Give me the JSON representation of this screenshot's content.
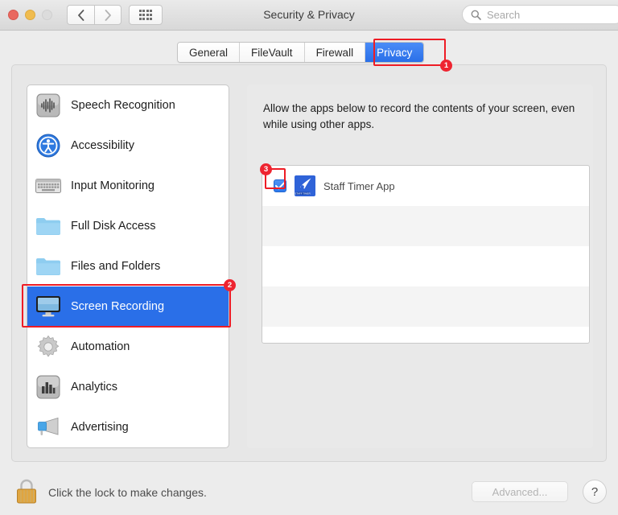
{
  "window": {
    "title": "Security & Privacy",
    "traffic_lights": [
      "close",
      "minimize",
      "zoom"
    ],
    "nav": {
      "back": "‹",
      "forward": "›",
      "grid": "grid-view-icon"
    },
    "search": {
      "value": "",
      "placeholder": "Search"
    }
  },
  "tabs": [
    {
      "label": "General",
      "active": false
    },
    {
      "label": "FileVault",
      "active": false
    },
    {
      "label": "Firewall",
      "active": false
    },
    {
      "label": "Privacy",
      "active": true
    }
  ],
  "sidebar": {
    "items": [
      {
        "label": "Speech Recognition",
        "icon": "waveform-icon",
        "selected": false
      },
      {
        "label": "Accessibility",
        "icon": "accessibility-icon",
        "selected": false
      },
      {
        "label": "Input Monitoring",
        "icon": "keyboard-icon",
        "selected": false
      },
      {
        "label": "Full Disk Access",
        "icon": "folder-icon",
        "selected": false
      },
      {
        "label": "Files and Folders",
        "icon": "folder-icon",
        "selected": false
      },
      {
        "label": "Screen Recording",
        "icon": "display-icon",
        "selected": true
      },
      {
        "label": "Automation",
        "icon": "gear-icon",
        "selected": false
      },
      {
        "label": "Analytics",
        "icon": "bar-chart-icon",
        "selected": false
      },
      {
        "label": "Advertising",
        "icon": "megaphone-icon",
        "selected": false
      }
    ]
  },
  "pane": {
    "description": "Allow the apps below to record the contents of your screen, even while using other apps.",
    "apps": [
      {
        "name": "Staff Timer App",
        "checked": true,
        "icon": "staff-timer-app-icon"
      },
      {
        "name": "",
        "checked": false,
        "icon": ""
      },
      {
        "name": "",
        "checked": false,
        "icon": ""
      },
      {
        "name": "",
        "checked": false,
        "icon": ""
      }
    ]
  },
  "footer": {
    "lock_text": "Click the lock to make changes.",
    "lock_icon": "lock-closed-icon",
    "advanced_label": "Advanced...",
    "help_label": "?"
  },
  "annotations": [
    {
      "badge": "1",
      "target": "privacy-tab"
    },
    {
      "badge": "2",
      "target": "screen-recording-sidebar-item"
    },
    {
      "badge": "3",
      "target": "staff-timer-checkbox"
    }
  ],
  "colors": {
    "accent_blue": "#2a6fe8",
    "annotation_red": "#ee1c25",
    "window_bg": "#ececec"
  }
}
